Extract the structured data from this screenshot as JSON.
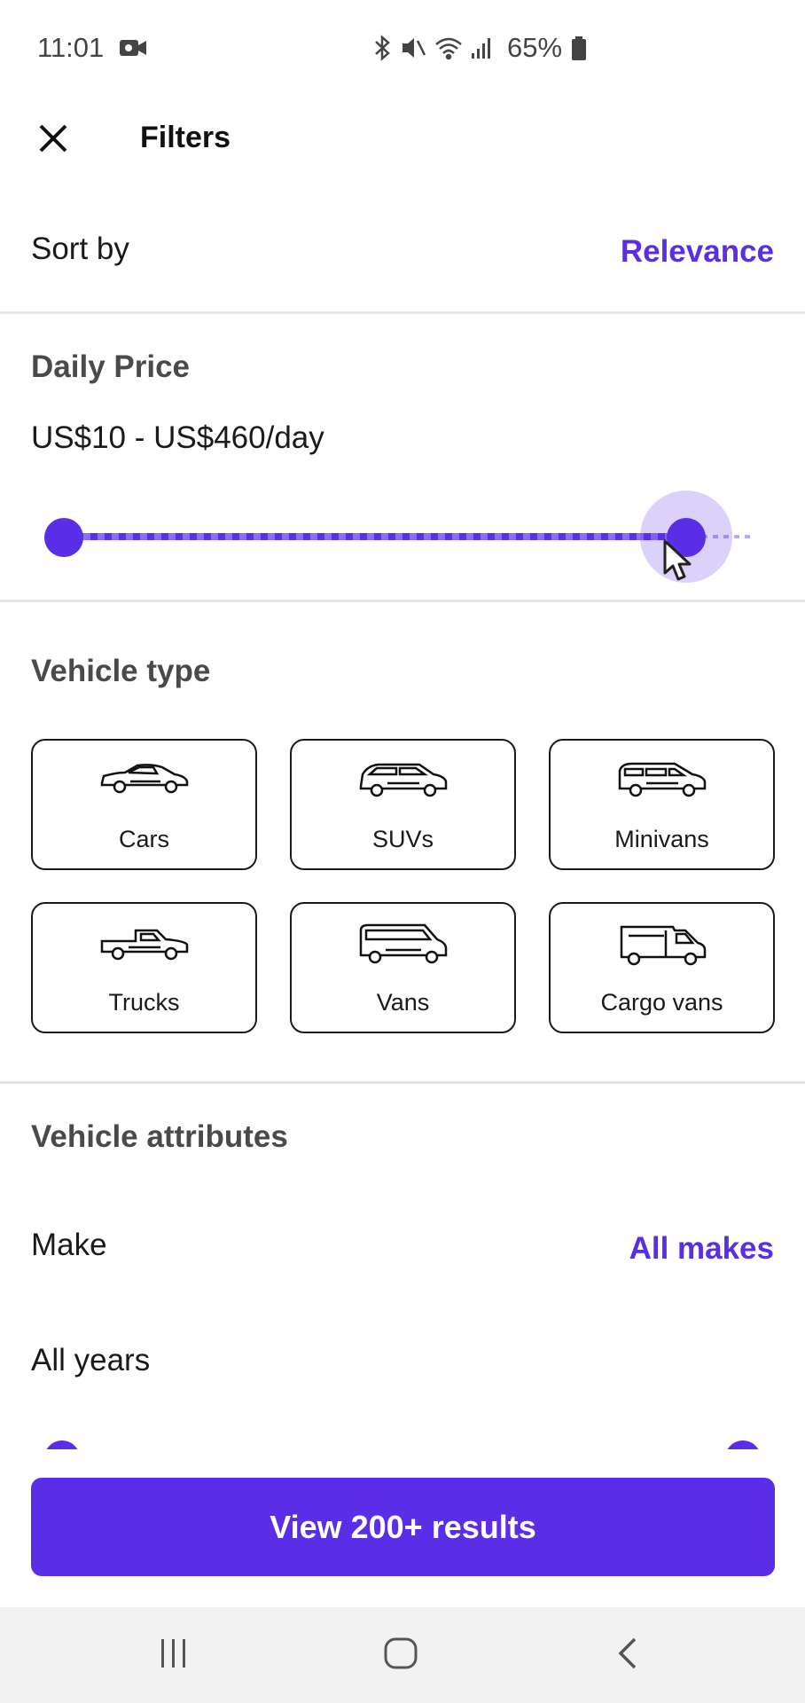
{
  "status_bar": {
    "time": "11:01",
    "battery_percent": "65%",
    "icons": [
      "video-record-icon",
      "bluetooth-icon",
      "mute-icon",
      "wifi-icon",
      "signal-icon",
      "battery-icon"
    ]
  },
  "header": {
    "title": "Filters",
    "close_icon": "close-icon"
  },
  "sort": {
    "label": "Sort by",
    "value": "Relevance"
  },
  "daily_price": {
    "title": "Daily Price",
    "range_text": "US$10 - US$460/day",
    "slider_min_fraction": 0.0,
    "slider_max_fraction": 0.91
  },
  "vehicle_type": {
    "title": "Vehicle type",
    "options": [
      {
        "label": "Cars",
        "icon": "car-icon"
      },
      {
        "label": "SUVs",
        "icon": "suv-icon"
      },
      {
        "label": "Minivans",
        "icon": "minivan-icon"
      },
      {
        "label": "Trucks",
        "icon": "truck-icon"
      },
      {
        "label": "Vans",
        "icon": "van-icon"
      },
      {
        "label": "Cargo vans",
        "icon": "cargo-van-icon"
      }
    ]
  },
  "vehicle_attributes": {
    "title": "Vehicle attributes",
    "make_label": "Make",
    "make_value": "All makes",
    "years_label": "All years"
  },
  "cta": {
    "label": "View 200+ results"
  },
  "colors": {
    "accent": "#5a2ee6",
    "text": "#1a1a1a",
    "divider": "#e6e6e6"
  }
}
